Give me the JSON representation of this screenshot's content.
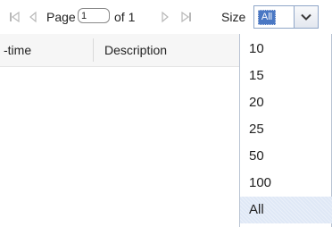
{
  "pager": {
    "page_label": "Page",
    "page_value": "1",
    "of_label": "of 1",
    "size_label": "Size",
    "size_value": "All"
  },
  "icons": {
    "first": "first-page-icon",
    "prev": "previous-page-icon",
    "next": "next-page-icon",
    "last": "last-page-icon",
    "dropdown": "chevron-down-icon"
  },
  "columns": [
    "-time",
    "Description"
  ],
  "size_options": [
    "10",
    "15",
    "20",
    "25",
    "50",
    "100",
    "All"
  ],
  "selected_size": "All",
  "colors": {
    "selected_value_bg": "#4a78c4",
    "selected_option_bg": "#dfe8f6",
    "disabled_icon": "#b8b8b8"
  }
}
